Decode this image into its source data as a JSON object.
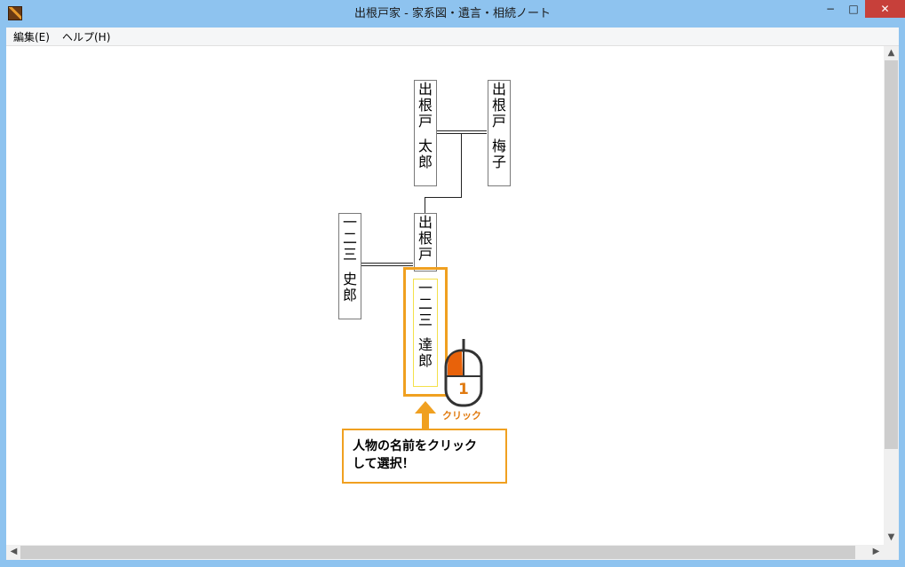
{
  "window": {
    "title": "出根戸家 - 家系図・遺言・相続ノート"
  },
  "controls": {
    "minimize": "−",
    "maximize": "□",
    "close": "✕"
  },
  "menu": [
    {
      "label": "編集(E)"
    },
    {
      "label": "ヘルプ(H)"
    }
  ],
  "family_tree": {
    "persons": [
      {
        "id": "taro",
        "surname": "出根戸",
        "given": "太郎"
      },
      {
        "id": "ume",
        "surname": "出根戸",
        "given": "梅子"
      },
      {
        "id": "fumio",
        "surname": "一二三",
        "given": "史郎"
      },
      {
        "id": "hanako",
        "surname": "出根戸",
        "given": ""
      },
      {
        "id": "tatsuro",
        "surname": "一二三",
        "given": "達郎"
      }
    ]
  },
  "tutorial": {
    "callout_line1": "人物の名前をクリック",
    "callout_line2": "して選択！",
    "mouse_step": "1",
    "mouse_label": "クリック",
    "accent_color": "#f0a020",
    "mouse_button_color": "#e8620a"
  }
}
